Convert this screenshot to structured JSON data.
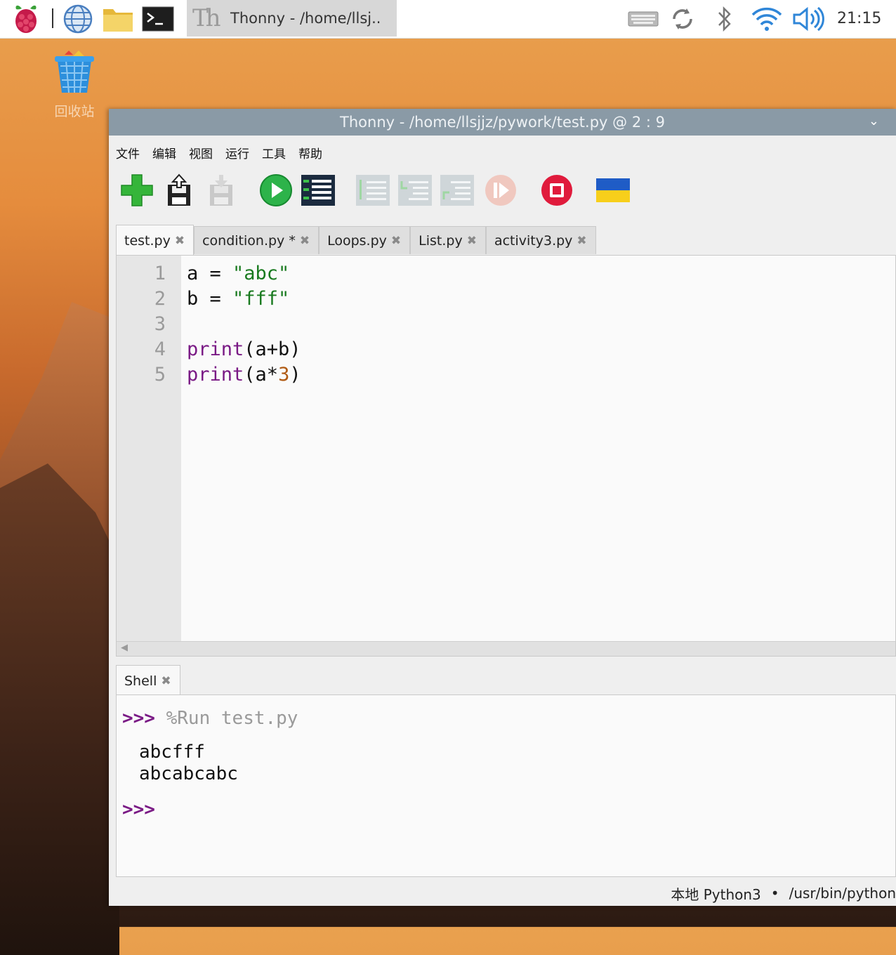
{
  "taskbar": {
    "task_title": "Thonny  -  /home/llsj..",
    "task_logo": "Th",
    "clock": "21:15",
    "icons": [
      "raspberry-menu-icon",
      "web-browser-icon",
      "file-manager-icon",
      "terminal-icon",
      "keyboard-icon",
      "sync-icon",
      "bluetooth-icon",
      "wifi-icon",
      "volume-icon"
    ]
  },
  "desktop": {
    "trash_label": "回收站"
  },
  "window": {
    "title": "Thonny  -  /home/llsjjz/pywork/test.py  @  2 : 9",
    "menu": [
      "文件",
      "编辑",
      "视图",
      "运行",
      "工具",
      "帮助"
    ],
    "toolbar": [
      "new",
      "load",
      "save",
      "run",
      "debug",
      "step-over",
      "step-into",
      "step-out",
      "resume",
      "stop",
      "support-ukraine"
    ],
    "editor_tabs": [
      {
        "label": "test.py"
      },
      {
        "label": "condition.py *"
      },
      {
        "label": "Loops.py"
      },
      {
        "label": "List.py"
      },
      {
        "label": "activity3.py"
      }
    ],
    "line_numbers": [
      "1",
      "2",
      "3",
      "4",
      "5"
    ],
    "code": {
      "l1_var": "a = ",
      "l1_str": "\"abc\"",
      "l2_var": "b = ",
      "l2_str": "\"fff\"",
      "l4_fn": "print",
      "l4_rest": "(a+b)",
      "l5_fn": "print",
      "l5_mid": "(a*",
      "l5_num": "3",
      "l5_end": ")"
    },
    "shell": {
      "tab_label": "Shell",
      "prompt": ">>>",
      "command": "%Run test.py",
      "output": [
        "abcfff",
        "abcabcabc"
      ],
      "prompt2": ">>>"
    },
    "status": {
      "interpreter": "本地 Python3",
      "dot": "•",
      "path": "/usr/bin/python"
    }
  },
  "colors": {
    "titlebar": "#8a9aa6",
    "keyword": "#7a1a85",
    "string": "#197a1f",
    "number": "#b05a12"
  }
}
